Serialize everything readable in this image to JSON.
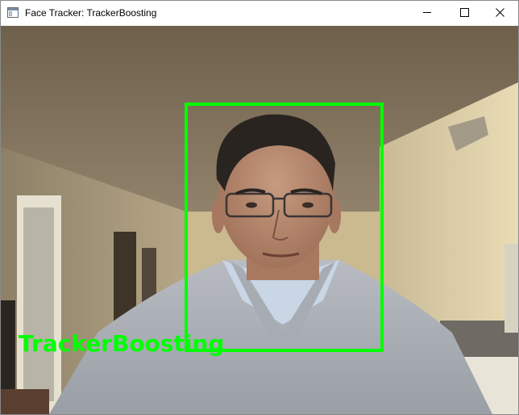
{
  "window": {
    "title": "Face Tracker: TrackerBoosting"
  },
  "overlay": {
    "tracker_label": "TrackerBoosting",
    "box_color": "#00ff00"
  },
  "icons": {
    "app": "app-window-icon",
    "minimize": "minimize-icon",
    "maximize": "maximize-icon",
    "close": "close-icon"
  }
}
